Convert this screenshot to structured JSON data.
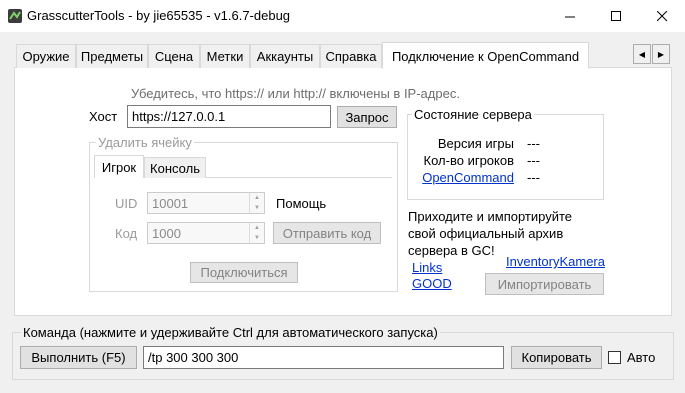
{
  "window": {
    "title": "GrasscutterTools - by jie65535 - v1.6.7-debug",
    "minimize_icon": "minimize-icon",
    "maximize_icon": "maximize-icon",
    "close_icon": "close-icon"
  },
  "tabs": [
    {
      "label": "Оружие"
    },
    {
      "label": "Предметы"
    },
    {
      "label": "Сцена"
    },
    {
      "label": "Метки"
    },
    {
      "label": "Аккаунты"
    },
    {
      "label": "Справка"
    },
    {
      "label": "Подключение к OpenCommand",
      "active": true
    }
  ],
  "connection": {
    "hint": "Убедитесь, что https:// или http:// включены в IP-адрес.",
    "host_label": "Хост",
    "host_value": "https://127.0.0.1",
    "query_button": "Запрос"
  },
  "remote": {
    "legend": "Удалить ячейку",
    "tabs": [
      {
        "label": "Игрок",
        "active": true
      },
      {
        "label": "Консоль"
      }
    ],
    "uid_label": "UID",
    "uid_value": "10001",
    "help_label": "Помощь",
    "code_label": "Код",
    "code_value": "1000",
    "send_code_button": "Отправить код",
    "connect_button": "Подключиться"
  },
  "server_status": {
    "legend": "Состояние сервера",
    "rows": [
      {
        "label": "Версия игры",
        "value": "---"
      },
      {
        "label": "Кол-во игроков",
        "value": "---"
      },
      {
        "label": "OpenCommand",
        "value": "---"
      }
    ]
  },
  "archive": {
    "text_line1": "Приходите и импортируйте",
    "text_line2": "свой официальный архив",
    "text_line3": "сервера в GC!",
    "link_links": "Links",
    "link_good": "GOOD",
    "link_inventory": "InventoryKamera",
    "import_button": "Импортировать"
  },
  "command": {
    "legend": "Команда (нажмите и удерживайте Ctrl для автоматического запуска)",
    "run_button": "Выполнить (F5)",
    "input_value": "/tp 300 300 300",
    "copy_button": "Копировать",
    "auto_label": "Авто",
    "auto_checked": false
  }
}
